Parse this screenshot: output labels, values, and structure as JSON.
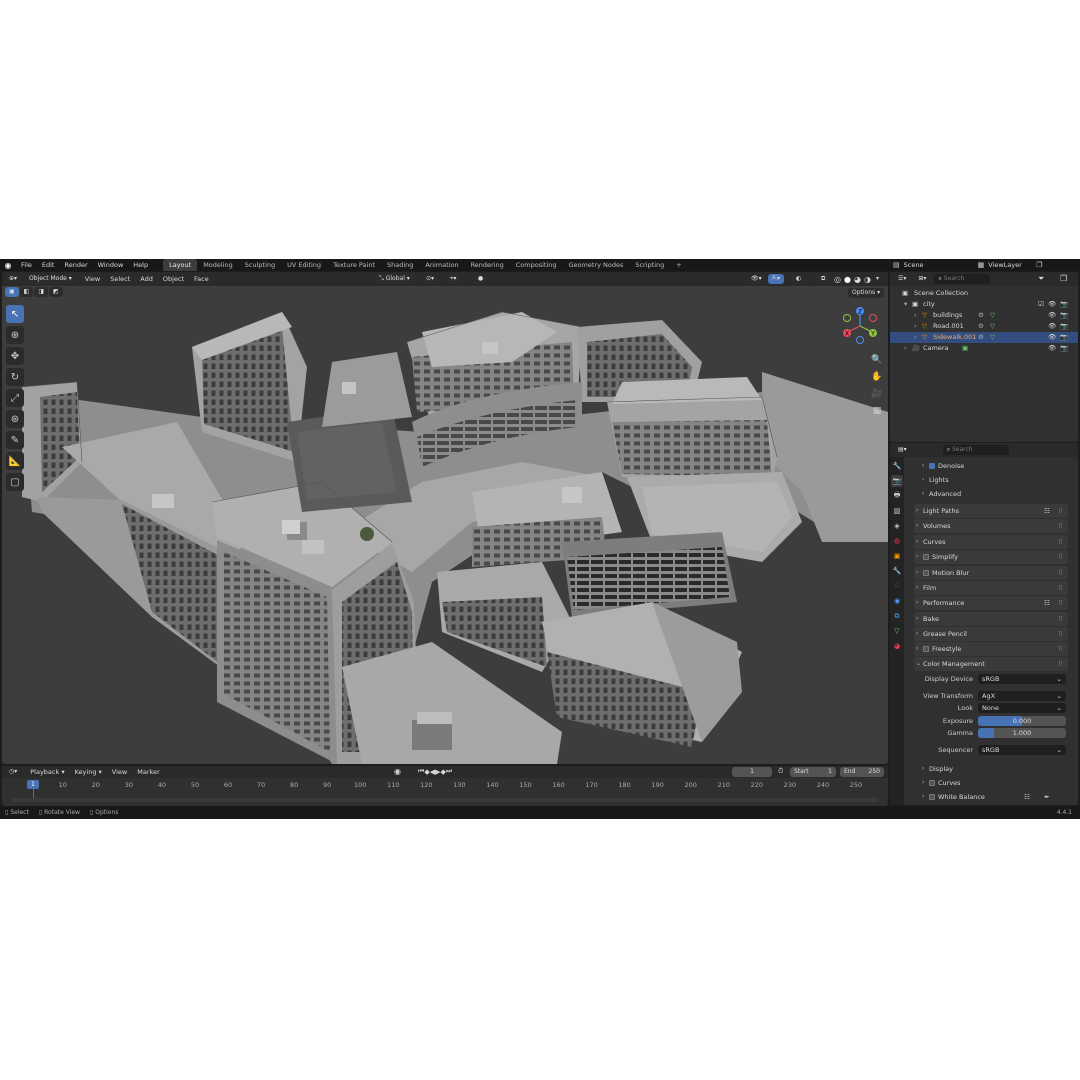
{
  "menus": [
    "File",
    "Edit",
    "Render",
    "Window",
    "Help"
  ],
  "workspaces": [
    "Layout",
    "Modeling",
    "Sculpting",
    "UV Editing",
    "Texture Paint",
    "Shading",
    "Animation",
    "Rendering",
    "Compositing",
    "Geometry Nodes",
    "Scripting"
  ],
  "active_workspace": "Layout",
  "scene_name": "Scene",
  "view_layer": "ViewLayer",
  "viewport": {
    "mode": "Object Mode",
    "menus": [
      "View",
      "Select",
      "Add",
      "Object",
      "Face"
    ],
    "orientation": "Global",
    "options": "Options"
  },
  "gizmo": {
    "x": "X",
    "y": "Y",
    "z": "Z"
  },
  "outliner": {
    "search_placeholder": "Search",
    "root": "Scene Collection",
    "items": [
      {
        "name": "city",
        "indent": 1
      },
      {
        "name": "buildings",
        "indent": 2
      },
      {
        "name": "Road.001",
        "indent": 2
      },
      {
        "name": "Sidewalk.001",
        "indent": 2,
        "selected": true
      },
      {
        "name": "Camera",
        "indent": 1
      }
    ]
  },
  "properties": {
    "search_placeholder": "Search",
    "denoise": "Denoise",
    "lights": "Lights",
    "advanced": "Advanced",
    "panels": [
      "Light Paths",
      "Volumes",
      "Curves",
      "Simplify",
      "Motion Blur",
      "Film",
      "Performance",
      "Bake",
      "Grease Pencil",
      "Freestyle",
      "Color Management"
    ],
    "color_management": {
      "display_device_label": "Display Device",
      "display_device": "sRGB",
      "view_transform_label": "View Transform",
      "view_transform": "AgX",
      "look_label": "Look",
      "look": "None",
      "exposure_label": "Exposure",
      "exposure": "0.000",
      "exposure_fill": 0.5,
      "gamma_label": "Gamma",
      "gamma": "1.000",
      "gamma_fill": 0.18,
      "sequencer_label": "Sequencer",
      "sequencer": "sRGB"
    },
    "subpanels": [
      "Display",
      "Curves",
      "White Balance"
    ]
  },
  "timeline": {
    "menus": [
      "Playback",
      "Keying",
      "View",
      "Marker"
    ],
    "current_frame": "1",
    "start_label": "Start",
    "start": "1",
    "end_label": "End",
    "end": "250",
    "ticks": [
      "1",
      "10",
      "20",
      "30",
      "40",
      "50",
      "60",
      "70",
      "80",
      "90",
      "100",
      "110",
      "120",
      "130",
      "140",
      "150",
      "160",
      "170",
      "180",
      "190",
      "200",
      "210",
      "220",
      "230",
      "240",
      "250"
    ]
  },
  "status": {
    "select": "Select",
    "rotate": "Rotate View",
    "options": "Options",
    "version": "4.4.1"
  },
  "colors": {
    "accent": "#4772b3",
    "selected_row": "#334d80",
    "background": "#1d1d1d",
    "viewport": "#3b3b3b"
  }
}
